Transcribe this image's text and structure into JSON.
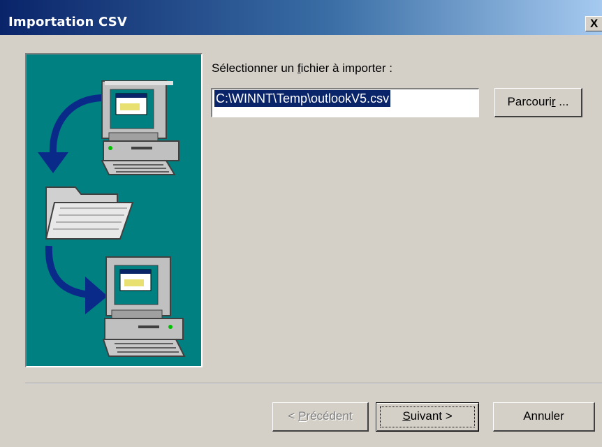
{
  "window": {
    "title": "Importation CSV",
    "close_label": "X"
  },
  "form": {
    "file_label_prefix": "Sélectionner un ",
    "file_label_mnemonic": "f",
    "file_label_suffix": "ichier à importer :",
    "file_value": "C:\\WINNT\\Temp\\outlookV5.csv",
    "browse_prefix": "Parcouri",
    "browse_mnemonic": "r",
    "browse_suffix": " ..."
  },
  "footer": {
    "prev_prefix": "< ",
    "prev_mnemonic": "P",
    "prev_suffix": "récédent",
    "next_mnemonic": "S",
    "next_suffix": "uivant >",
    "cancel_label": "Annuler"
  },
  "colors": {
    "titlebar_start": "#0a246a",
    "titlebar_end": "#a6caf0",
    "illustration_bg": "#008080",
    "dialog_bg": "#d4d0c8",
    "arrow": "#0a2a8a"
  },
  "icons": [
    "computer-icon",
    "folder-icon",
    "arrow-icon"
  ]
}
